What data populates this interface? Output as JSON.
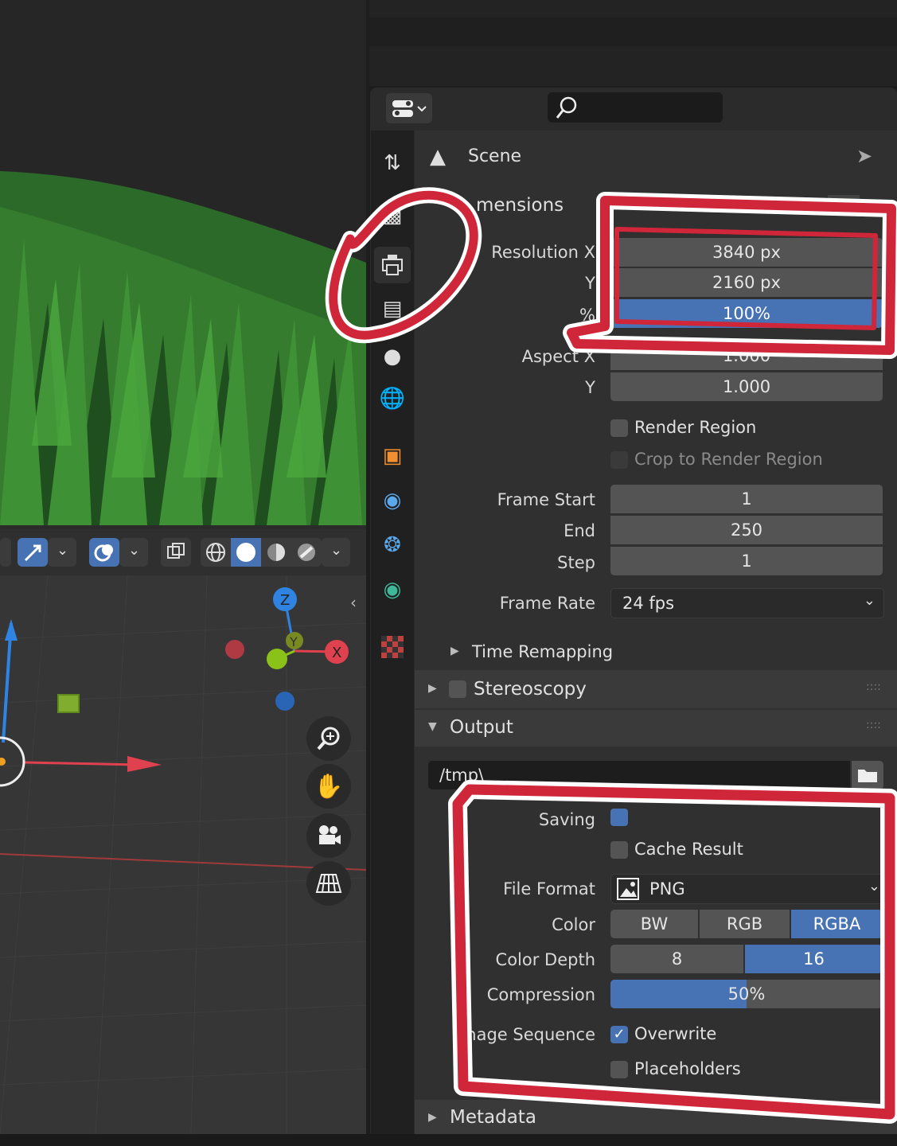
{
  "header": {
    "search_placeholder": ""
  },
  "context": {
    "title": "Scene"
  },
  "dimensions": {
    "title": "mensions",
    "resolution_x_label": "Resolution X",
    "resolution_x": "3840 px",
    "y_label": "Y",
    "resolution_y": "2160 px",
    "percent_label": "%",
    "resolution_percent": "100%",
    "aspect_x_label": "Aspect X",
    "aspect_x": "1.000",
    "aspect_y_label": "Y",
    "aspect_y": "1.000",
    "render_region": "Render Region",
    "crop_region": "Crop to Render Region",
    "frame_start_label": "Frame Start",
    "frame_start": "1",
    "end_label": "End",
    "frame_end": "250",
    "step_label": "Step",
    "frame_step": "1",
    "frame_rate_label": "Frame Rate",
    "frame_rate": "24 fps",
    "time_remapping": "Time Remapping"
  },
  "stereoscopy": {
    "title": "Stereoscopy"
  },
  "output": {
    "title": "Output",
    "path": "/tmp\\",
    "saving_label": "Saving",
    "cache_result": "Cache Result",
    "file_format_label": "File Format",
    "file_format": "PNG",
    "color_label": "Color",
    "color_options": [
      "BW",
      "RGB",
      "RGBA"
    ],
    "color_selected": "RGBA",
    "depth_label": "Color Depth",
    "depth_options": [
      "8",
      "16"
    ],
    "depth_selected": "16",
    "compression_label": "Compression",
    "compression": "50%",
    "compression_value": 0.5,
    "sequence_label": "nage Sequence",
    "overwrite": "Overwrite",
    "placeholders": "Placeholders"
  },
  "metadata": {
    "title": "Metadata"
  },
  "gizmo": {
    "z": "Z",
    "y": "Y",
    "x": "X"
  },
  "colors": {
    "accent": "#4772b3",
    "annotation": "#d0263a",
    "axis_x": "#e0414f",
    "axis_y": "#8bc219",
    "axis_z": "#2f84e3"
  }
}
